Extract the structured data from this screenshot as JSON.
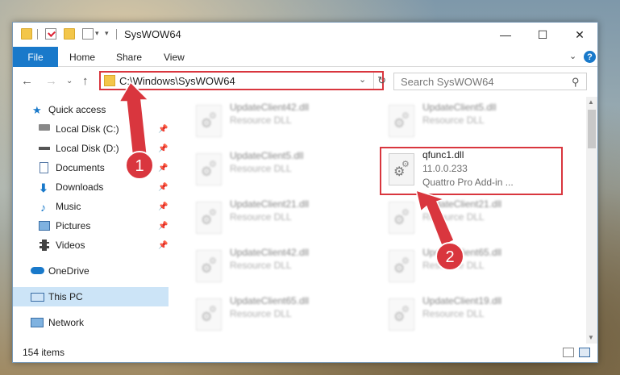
{
  "window": {
    "title": "SysWOW64",
    "minimize": "—",
    "maximize": "☐",
    "close": "✕"
  },
  "ribbon": {
    "tabs": [
      "File",
      "Home",
      "Share",
      "View"
    ],
    "expand": "⌄",
    "help": "?"
  },
  "nav": {
    "back": "←",
    "forward": "→",
    "recent": "⌄",
    "up": "↑",
    "address": "C:\\Windows\\SysWOW64",
    "search_placeholder": "Search SysWOW64"
  },
  "sidebar": {
    "items": [
      {
        "label": "Quick access",
        "icon": "star-icon"
      },
      {
        "label": "Local Disk (C:)",
        "icon": "drive-icon",
        "pinned": true
      },
      {
        "label": "Local Disk (D:)",
        "icon": "drive-icon",
        "pinned": true
      },
      {
        "label": "Documents",
        "icon": "documents-icon",
        "pinned": true
      },
      {
        "label": "Downloads",
        "icon": "downloads-icon",
        "pinned": true
      },
      {
        "label": "Music",
        "icon": "music-icon",
        "pinned": true
      },
      {
        "label": "Pictures",
        "icon": "pictures-icon",
        "pinned": true
      },
      {
        "label": "Videos",
        "icon": "videos-icon",
        "pinned": true
      },
      {
        "label": "OneDrive",
        "icon": "cloud-icon"
      },
      {
        "label": "This PC",
        "icon": "pc-icon",
        "selected": true
      },
      {
        "label": "Network",
        "icon": "network-icon"
      }
    ]
  },
  "files": {
    "left_column": [
      {
        "name": "UpdateClient42.dll",
        "type": "Resource DLL"
      },
      {
        "name": "UpdateClient5.dll",
        "type": "Resource DLL"
      },
      {
        "name": "UpdateClient21.dll",
        "type": "Resource DLL"
      },
      {
        "name": "UpdateClient42.dll",
        "type": "Resource DLL"
      },
      {
        "name": "UpdateClient65.dll",
        "type": "Resource DLL"
      }
    ],
    "right_column": [
      {
        "name": "UpdateClient5.dll",
        "type": "Resource DLL"
      },
      {
        "name": "UpdateClient21.dll",
        "type": "Resource DLL"
      },
      {
        "name": "UpdateClient65.dll",
        "type": "Resource DLL"
      },
      {
        "name": "UpdateClient19.dll",
        "type": "Resource DLL"
      }
    ],
    "highlighted": {
      "name": "qfunc1.dll",
      "version": "11.0.0.233",
      "description": "Quattro Pro Add-in ..."
    }
  },
  "status": {
    "item_count": "154 items"
  },
  "annotations": {
    "step1": "1",
    "step2": "2",
    "color": "#d9363e"
  }
}
